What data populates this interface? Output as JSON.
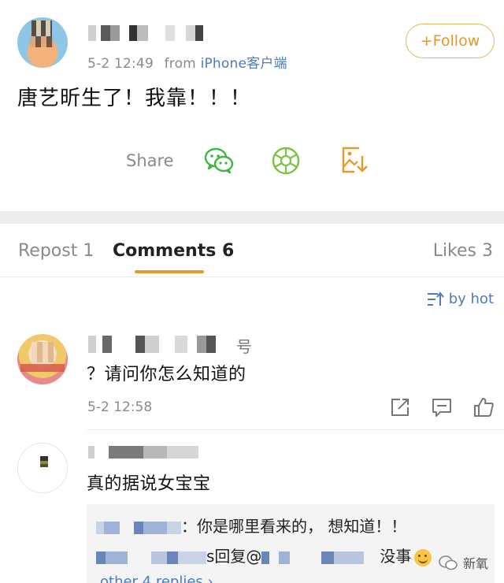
{
  "post": {
    "time": "5-2 12:49",
    "from_label": "from",
    "source": "iPhone客户端",
    "follow_label": "+Follow",
    "text": "唐艺昕生了！我靠！！！"
  },
  "share": {
    "label": "Share",
    "icons": [
      "wechat-icon",
      "moments-icon",
      "save-image-icon"
    ]
  },
  "tabs": [
    {
      "label": "Repost 1"
    },
    {
      "label": "Comments 6"
    },
    {
      "label": "Likes 3"
    }
  ],
  "sort": {
    "label": "by hot"
  },
  "comments": [
    {
      "name_tail": "号",
      "text": "？请问你怎么知道的",
      "time": "5-2 12:58"
    },
    {
      "text": "真的据说女宝宝",
      "replies": [
        {
          "tail": "：你是哪里看来的， 想知道！！"
        },
        {
          "mid": "s回复@",
          "tail": "没事"
        }
      ],
      "more": "other 4 replies ›"
    }
  ],
  "watermark": {
    "text": "新氧"
  },
  "colors": {
    "accent": "#e39a2a",
    "link": "#4d7ab8",
    "wechat": "#3fb73f"
  }
}
